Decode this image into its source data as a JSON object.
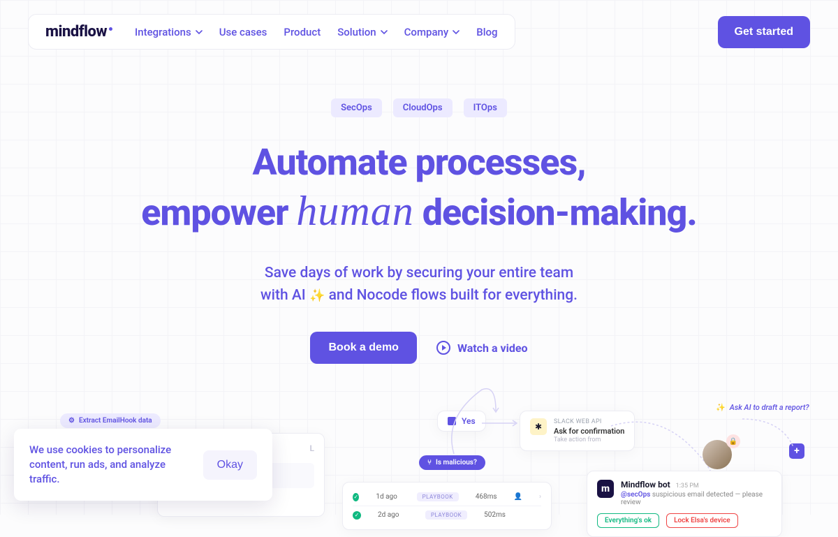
{
  "nav": {
    "logo": "mindflow",
    "links": [
      "Integrations",
      "Use cases",
      "Product",
      "Solution",
      "Company",
      "Blog"
    ],
    "dropdowns": [
      true,
      false,
      false,
      true,
      true,
      false
    ],
    "cta": "Get started"
  },
  "hero": {
    "tags": [
      "SecOps",
      "CloudOps",
      "ITOps"
    ],
    "headline_line1": "Automate processes,",
    "headline_line2_a": "empower ",
    "headline_line2_cursive": "human",
    "headline_line2_b": " decision-making.",
    "sub_line1_a": "Save days of work by securing your entire team",
    "sub_line2": "with AI ",
    "sub_line2_b": " and Nocode flows built for everything.",
    "cta_primary": "Book a demo",
    "cta_secondary": "Watch a video"
  },
  "illus": {
    "extract_pill": "Extract EmailHook data",
    "yes_pill": "Yes",
    "malicious_pill": "Is malicious?",
    "slack_title": "SLACK WEB API",
    "slack_sub": "Ask for confirmation",
    "slack_sub2": "Take action from",
    "ai_prompt": "Ask AI to draft a report?",
    "bot_name": "Mindflow bot",
    "bot_time": "1:35 PM",
    "bot_mention": "@secOps",
    "bot_msg": " suspicious email detected — please review",
    "btn_ok": "Everything's ok",
    "btn_lock": "Lock Elsa's device",
    "row1_time": "1d ago",
    "row1_type": "PLAYBOOK",
    "row1_dur": "468ms",
    "row2_time": "2d ago",
    "row2_type": "PLAYBOOK",
    "row2_dur": "502ms",
    "panel_letter": "L"
  },
  "cookie": {
    "text": "We use cookies to personalize content, run ads, and analyze traffic.",
    "button": "Okay"
  }
}
